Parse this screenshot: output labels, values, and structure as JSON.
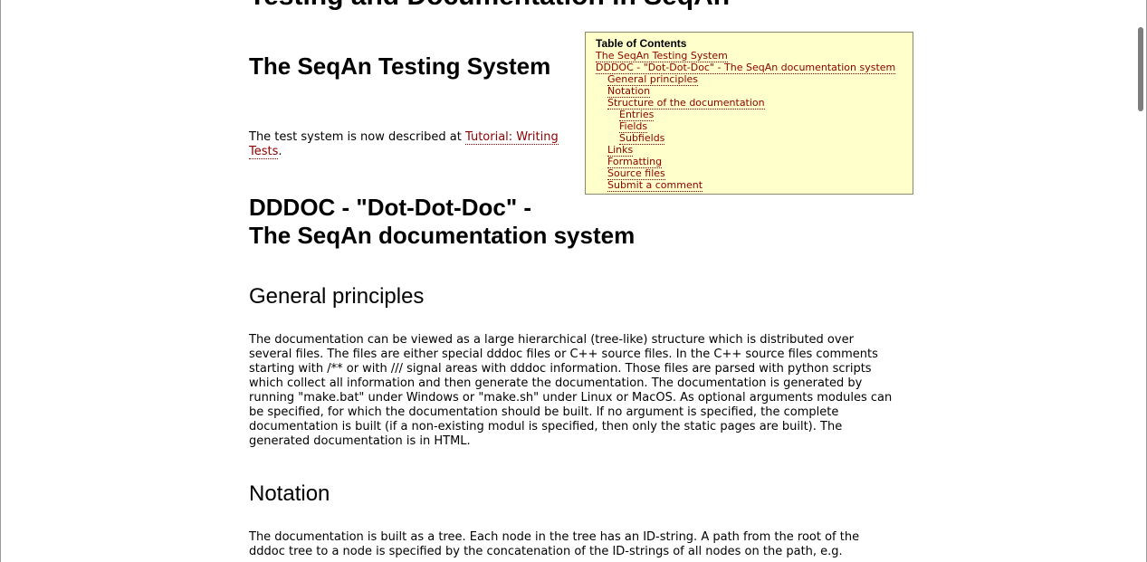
{
  "page": {
    "title": "Testing and Documentation in SeqAn"
  },
  "sections": {
    "testing": {
      "title": "The SeqAn Testing System",
      "para_prefix": "The test system is now described at ",
      "link_line1": "Tutorial: Writing",
      "link_line2": "Tests",
      "para_suffix": "."
    },
    "dddoc": {
      "title_line1": "DDDOC - \"Dot-Dot-Doc\" -",
      "title_line2": "The SeqAn documentation system"
    },
    "principles": {
      "title": "General principles",
      "lines": [
        "The documentation can be viewed as a large hierarchical (tree-like) structure which is distributed over",
        "several files. The files are either special dddoc files or C++ source files. In the C++ source files comments",
        "starting with /** or with /// signal areas with dddoc information. Those files are parsed with python scripts",
        "which collect all information and then generate the documentation. The documentation is generated by",
        "running \"make.bat\" under Windows or \"make.sh\" under Linux or MacOS. As optional arguments modules can",
        "be specified, for which the documentation should be built. If no argument is specified, the complete",
        "documentation is built (if a non-existing modul is specified, then only the static pages are built). The",
        "generated documentation is in HTML."
      ]
    },
    "notation": {
      "title": "Notation",
      "lines": [
        "The documentation is built as a tree. Each node in the tree has an ID-string. A path from the root of the",
        "dddoc tree to a node is specified by the concatenation of the ID-strings of all nodes on the path, e.g."
      ]
    }
  },
  "toc": {
    "title": "Table of Contents",
    "items": [
      {
        "label": "The SeqAn Testing System",
        "level": 1
      },
      {
        "label": "DDDOC - \"Dot-Dot-Doc\" - The SeqAn documentation system",
        "level": 1
      },
      {
        "label": "General principles",
        "level": 2
      },
      {
        "label": "Notation",
        "level": 2
      },
      {
        "label": "Structure of the documentation",
        "level": 2
      },
      {
        "label": "Entries",
        "level": 3
      },
      {
        "label": "Fields",
        "level": 3
      },
      {
        "label": "Subfields",
        "level": 3
      },
      {
        "label": "Links",
        "level": 2
      },
      {
        "label": "Formatting",
        "level": 2
      },
      {
        "label": "Source files",
        "level": 2
      },
      {
        "label": "Submit a comment",
        "level": 2
      }
    ]
  },
  "colors": {
    "link": "#8b0000",
    "toc_background": "#ffffcc"
  }
}
